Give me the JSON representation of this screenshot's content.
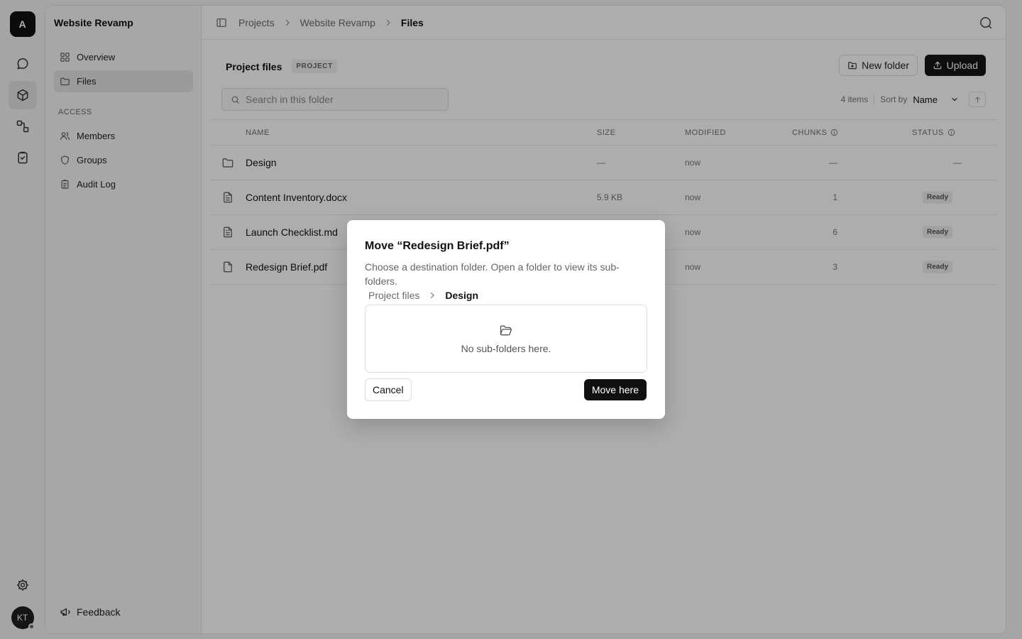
{
  "rail": {
    "logo_letter": "A",
    "avatar_initials": "KT",
    "icons": [
      "chat-icon",
      "cube-icon",
      "workflow-icon",
      "clipboard-check-icon",
      "gear-icon"
    ]
  },
  "sidebar": {
    "title": "Website Revamp",
    "items": [
      {
        "label": "Overview",
        "icon": "grid-icon",
        "active": false
      },
      {
        "label": "Files",
        "icon": "folder-icon",
        "active": true
      }
    ],
    "access_label": "ACCESS",
    "access_items": [
      {
        "label": "Members",
        "icon": "users-icon"
      },
      {
        "label": "Groups",
        "icon": "shield-icon"
      },
      {
        "label": "Audit Log",
        "icon": "clipboard-icon"
      }
    ],
    "feedback_label": "Feedback"
  },
  "breadcrumb": {
    "items": [
      "Projects",
      "Website Revamp",
      "Files"
    ]
  },
  "page": {
    "title": "Project files",
    "badge": "PROJECT",
    "new_folder_label": "New folder",
    "upload_label": "Upload",
    "search_placeholder": "Search in this folder",
    "items_count": "4 items",
    "sort_by_label": "Sort by",
    "sort_value": "Name"
  },
  "table": {
    "columns": [
      "NAME",
      "SIZE",
      "MODIFIED",
      "CHUNKS",
      "STATUS"
    ],
    "rows": [
      {
        "icon": "folder-icon",
        "name": "Design",
        "size": "—",
        "modified": "now",
        "chunks": "—",
        "status": "—"
      },
      {
        "icon": "document-icon",
        "name": "Content Inventory.docx",
        "size": "5.9 KB",
        "modified": "now",
        "chunks": "1",
        "status": "Ready"
      },
      {
        "icon": "document-icon",
        "name": "Launch Checklist.md",
        "size": "",
        "modified": "now",
        "chunks": "6",
        "status": "Ready"
      },
      {
        "icon": "file-icon",
        "name": "Redesign Brief.pdf",
        "size": "",
        "modified": "now",
        "chunks": "3",
        "status": "Ready"
      }
    ]
  },
  "modal": {
    "title": "Move “Redesign Brief.pdf”",
    "description": "Choose a destination folder. Open a folder to view its sub-folders.",
    "crumbs": [
      "Project files",
      "Design"
    ],
    "empty_text": "No sub-folders here.",
    "cancel_label": "Cancel",
    "move_label": "Move here"
  },
  "colors": {
    "accent_dark": "#111111",
    "overlay": "rgba(0,0,0,0.32)",
    "background": "#f4f4f4"
  }
}
